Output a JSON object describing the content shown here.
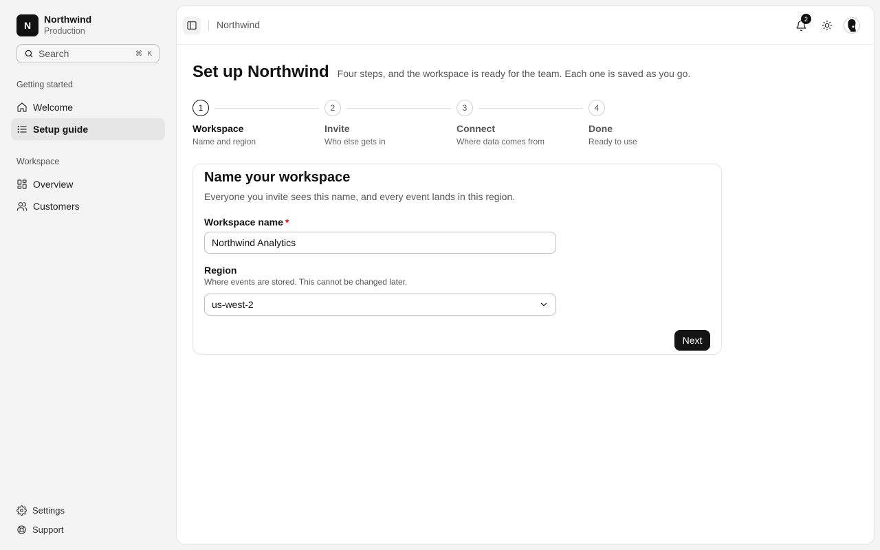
{
  "org": {
    "initial": "N",
    "name": "Northwind",
    "env": "Production"
  },
  "search": {
    "placeholder": "Search",
    "kbd_mod": "⌘",
    "kbd_key": "K"
  },
  "sidebar": {
    "sections": [
      {
        "label": "Getting started",
        "items": [
          {
            "label": "Welcome",
            "icon": "home-icon",
            "active": false
          },
          {
            "label": "Setup guide",
            "icon": "list-icon",
            "active": true
          }
        ]
      },
      {
        "label": "Workspace",
        "items": [
          {
            "label": "Overview",
            "icon": "grid-icon",
            "active": false
          },
          {
            "label": "Customers",
            "icon": "users-icon",
            "active": false
          }
        ]
      }
    ],
    "footer": [
      {
        "label": "Settings",
        "icon": "gear-icon"
      },
      {
        "label": "Support",
        "icon": "lifebuoy-icon"
      }
    ]
  },
  "topbar": {
    "breadcrumb": "Northwind",
    "notifications_count": "2",
    "icons": [
      "sidebar-toggle-icon",
      "bell-icon",
      "sun-icon",
      "avatar"
    ]
  },
  "page": {
    "title": "Set up Northwind",
    "subtitle": "Four steps, and the workspace is ready for the team. Each one is saved as you go."
  },
  "steps": [
    {
      "number": "1",
      "title": "Workspace",
      "desc": "Name and region",
      "current": true
    },
    {
      "number": "2",
      "title": "Invite",
      "desc": "Who else gets in",
      "current": false
    },
    {
      "number": "3",
      "title": "Connect",
      "desc": "Where data comes from",
      "current": false
    },
    {
      "number": "4",
      "title": "Done",
      "desc": "Ready to use",
      "current": false
    }
  ],
  "form": {
    "title": "Name your workspace",
    "subtitle": "Everyone you invite sees this name, and every event lands in this region.",
    "name_label": "Workspace name",
    "required_mark": "*",
    "name_value": "Northwind Analytics",
    "region_label": "Region",
    "region_help": "Where events are stored. This cannot be changed later.",
    "region_value": "us-west-2",
    "next_label": "Next"
  },
  "colors": {
    "accent": "#141414",
    "required": "#dd1111",
    "active_nav_bg": "#e6e6e6"
  }
}
